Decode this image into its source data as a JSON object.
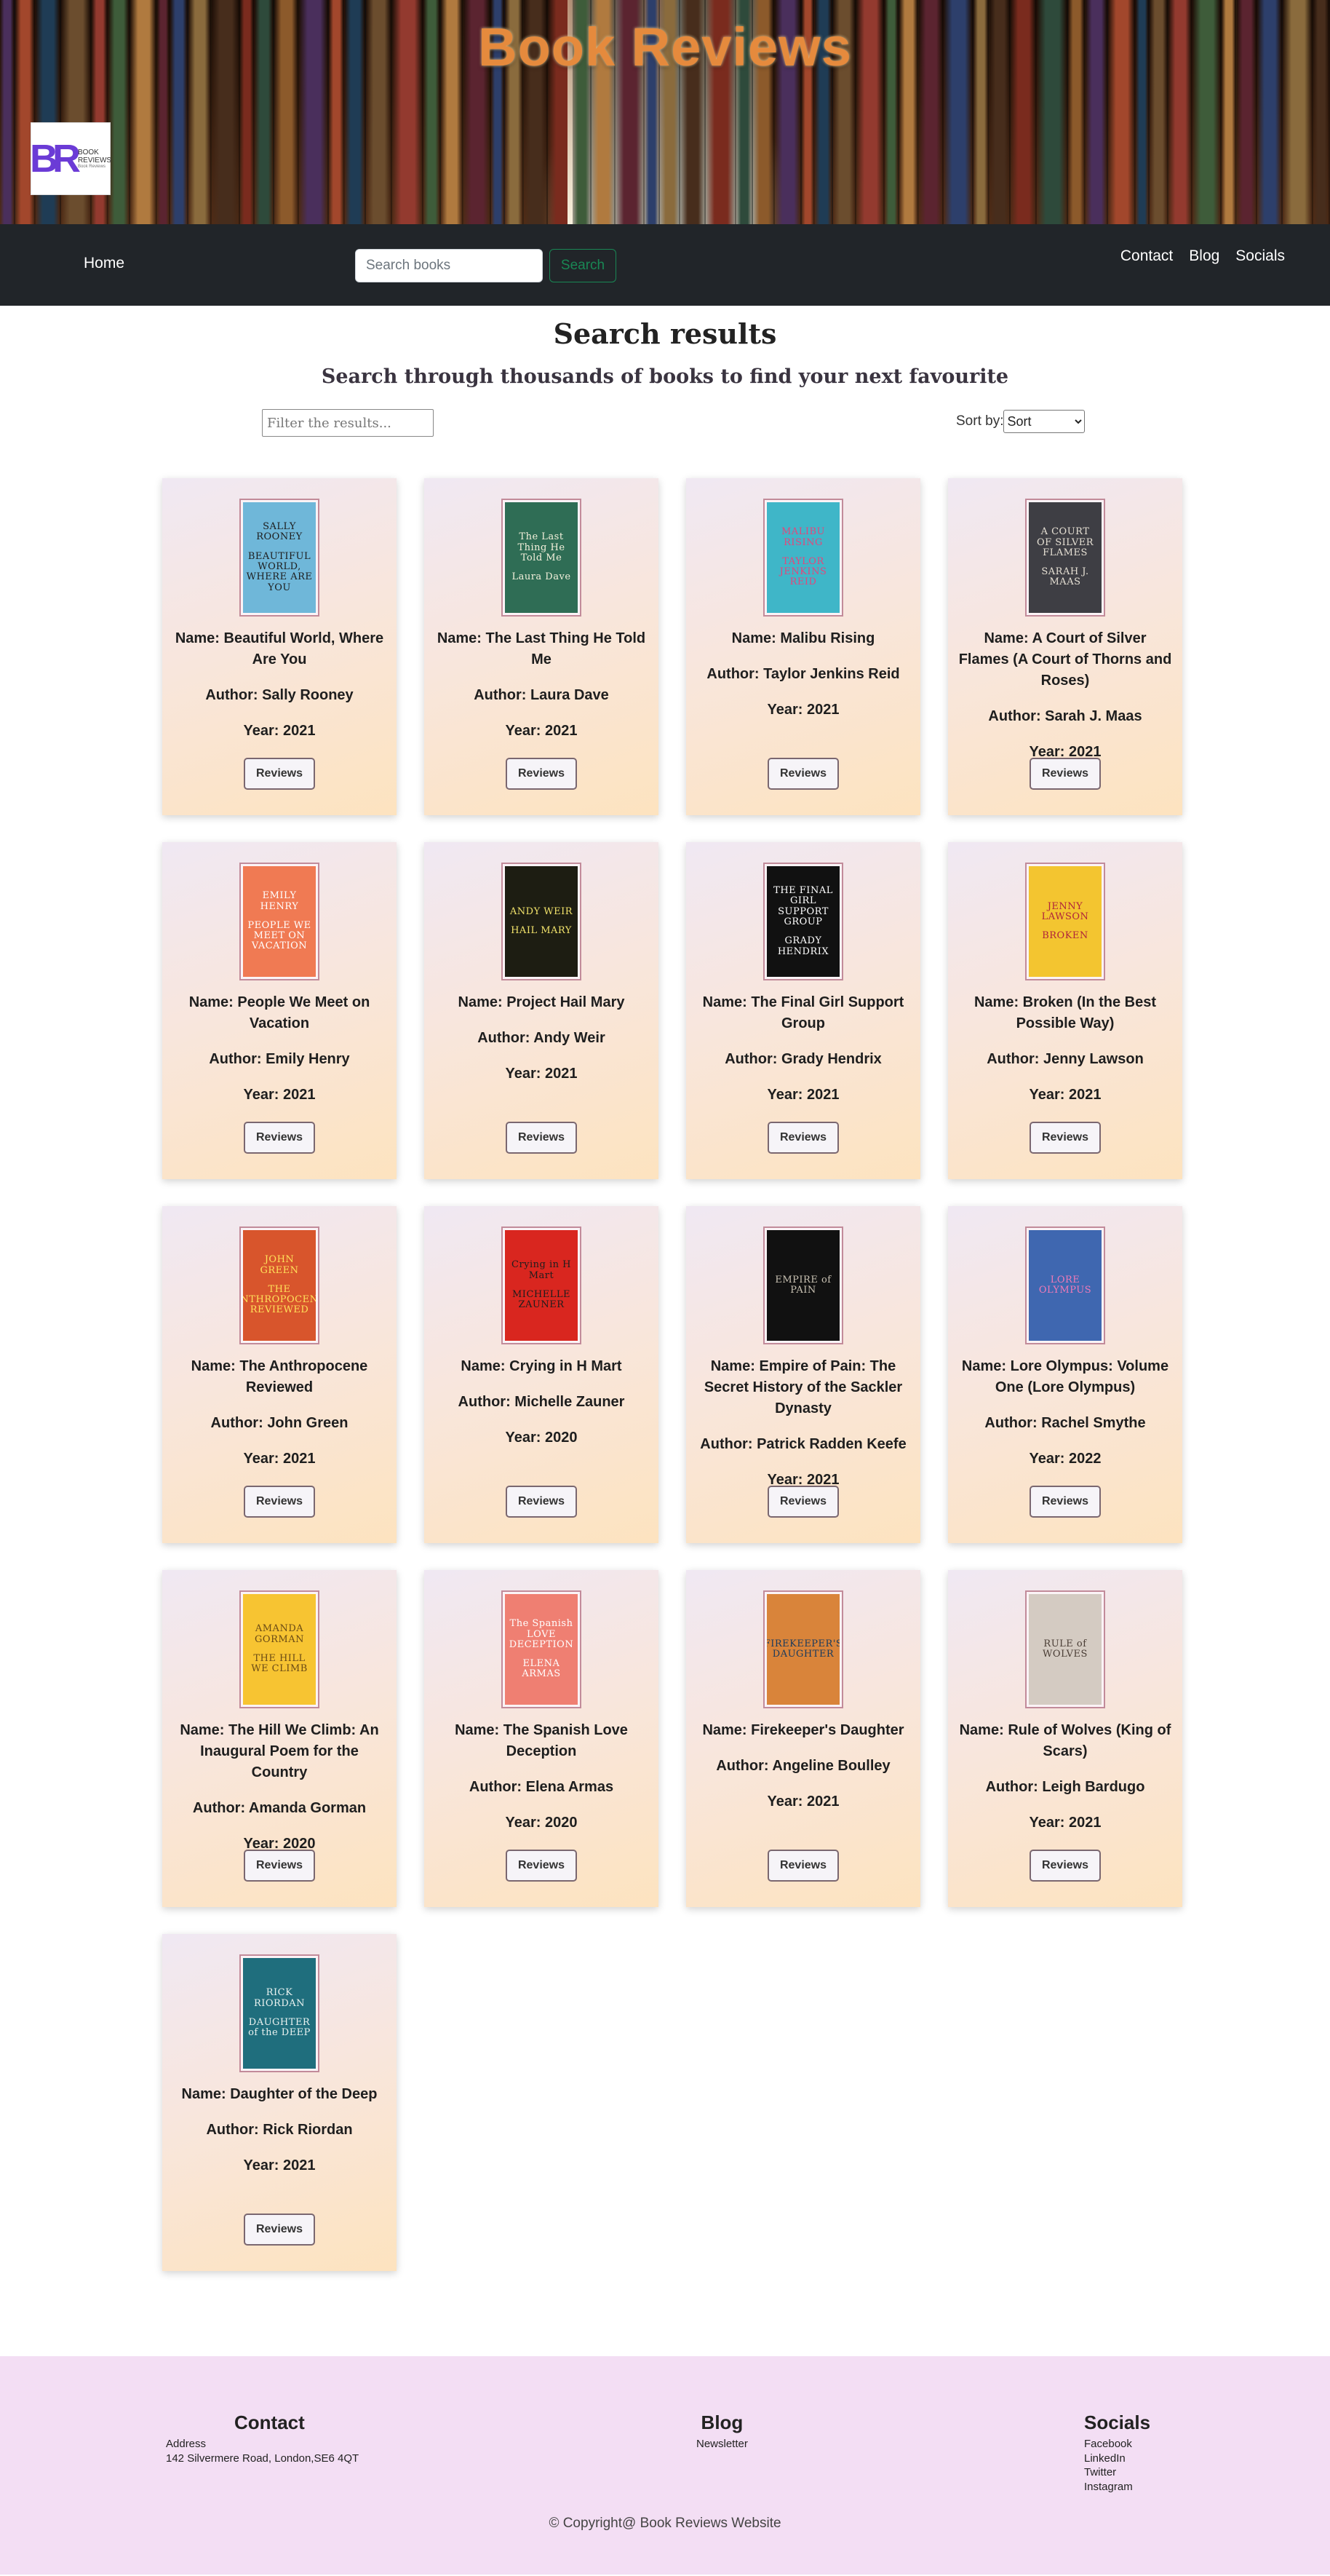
{
  "hero": {
    "title": "Book Reviews",
    "logo_mark": "BR",
    "logo_line1": "BOOK REVIEWS",
    "logo_line2": "Book Reviews"
  },
  "nav": {
    "home": "Home",
    "search_placeholder": "Search books",
    "search_button": "Search",
    "links": [
      "Contact",
      "Blog",
      "Socials"
    ]
  },
  "page": {
    "title": "Search results",
    "subtitle": "Search through thousands of books to find your next favourite",
    "filter_placeholder": "Filter the results...",
    "sort_label": "Sort by:",
    "sort_selected": "Sort"
  },
  "card_labels": {
    "name": "Name: ",
    "author": "Author: ",
    "year": "Year: ",
    "button": "Reviews"
  },
  "books": [
    {
      "name": "Beautiful World, Where Are You",
      "author": "Sally Rooney",
      "year": "2021",
      "cover_text": "SALLY ROONEY\nBEAUTIFUL WORLD, WHERE ARE YOU",
      "cover_bg": "#6fb7d9",
      "cover_fg": "#1d1d1d"
    },
    {
      "name": "The Last Thing He Told Me",
      "author": "Laura Dave",
      "year": "2021",
      "cover_text": "The Last Thing He Told Me\nLaura Dave",
      "cover_bg": "#2f6d55",
      "cover_fg": "#f4f1dc"
    },
    {
      "name": "Malibu Rising",
      "author": "Taylor Jenkins Reid",
      "year": "2021",
      "cover_text": "MALIBU RISING\nTAYLOR JENKINS REID",
      "cover_bg": "#3fb6c8",
      "cover_fg": "#e3477b"
    },
    {
      "name": "A Court of Silver Flames (A Court of Thorns and Roses)",
      "author": "Sarah J. Maas",
      "year": "2021",
      "cover_text": "A COURT OF SILVER FLAMES\nSARAH J. MAAS",
      "cover_bg": "#3e3e44",
      "cover_fg": "#e6e0d4"
    },
    {
      "name": "People We Meet on Vacation",
      "author": "Emily Henry",
      "year": "2021",
      "cover_text": "EMILY HENRY\nPEOPLE WE MEET ON VACATION",
      "cover_bg": "#f07a53",
      "cover_fg": "#ffffff"
    },
    {
      "name": "Project Hail Mary",
      "author": "Andy Weir",
      "year": "2021",
      "cover_text": "ANDY WEIR\nHAIL MARY",
      "cover_bg": "#1d1d12",
      "cover_fg": "#f2e36b"
    },
    {
      "name": "The Final Girl Support Group",
      "author": "Grady Hendrix",
      "year": "2021",
      "cover_text": "THE FINAL GIRL SUPPORT GROUP\nGRADY HENDRIX",
      "cover_bg": "#111111",
      "cover_fg": "#ffffff"
    },
    {
      "name": "Broken (In the Best Possible Way)",
      "author": "Jenny Lawson",
      "year": "2021",
      "cover_text": "JENNY LAWSON\nBROKEN",
      "cover_bg": "#f3c530",
      "cover_fg": "#b0233b"
    },
    {
      "name": "The Anthropocene Reviewed",
      "author": "John Green",
      "year": "2021",
      "cover_text": "JOHN GREEN\nTHE ANTHROPOCENE REVIEWED",
      "cover_bg": "#d8552c",
      "cover_fg": "#ffe15a"
    },
    {
      "name": "Crying in H Mart",
      "author": "Michelle Zauner",
      "year": "2020",
      "cover_text": "Crying in H Mart\nMICHELLE ZAUNER",
      "cover_bg": "#d9261f",
      "cover_fg": "#1d1d1d"
    },
    {
      "name": "Empire of Pain: The Secret History of the Sackler Dynasty",
      "author": "Patrick Radden Keefe",
      "year": "2021",
      "cover_text": "EMPIRE of PAIN",
      "cover_bg": "#111111",
      "cover_fg": "#c9c2b3"
    },
    {
      "name": "Lore Olympus: Volume One (Lore Olympus)",
      "author": "Rachel Smythe",
      "year": "2022",
      "cover_text": "LORE OLYMPUS",
      "cover_bg": "#3f67b0",
      "cover_fg": "#f07ab8"
    },
    {
      "name": "The Hill We Climb: An Inaugural Poem for the Country",
      "author": "Amanda Gorman",
      "year": "2020",
      "cover_text": "AMANDA GORMAN\nTHE HILL WE CLIMB",
      "cover_bg": "#f7c432",
      "cover_fg": "#6a4a15"
    },
    {
      "name": "The Spanish Love Deception",
      "author": "Elena Armas",
      "year": "2020",
      "cover_text": "The Spanish LOVE DECEPTION\nELENA ARMAS",
      "cover_bg": "#ef7f72",
      "cover_fg": "#ffffff"
    },
    {
      "name": "Firekeeper's Daughter",
      "author": "Angeline Boulley",
      "year": "2021",
      "cover_text": "FIREKEEPER'S DAUGHTER",
      "cover_bg": "#d9843a",
      "cover_fg": "#183a5e"
    },
    {
      "name": "Rule of Wolves (King of Scars)",
      "author": "Leigh Bardugo",
      "year": "2021",
      "cover_text": "RULE of WOLVES",
      "cover_bg": "#d4cbc2",
      "cover_fg": "#4a3d35"
    },
    {
      "name": "Daughter of the Deep",
      "author": "Rick Riordan",
      "year": "2021",
      "cover_text": "RICK RIORDAN\nDAUGHTER of the DEEP",
      "cover_bg": "#1f6e7d",
      "cover_fg": "#e9f2f0"
    }
  ],
  "footer": {
    "contact_title": "Contact",
    "address_label": "Address",
    "address": "142 Silvermere Road, London,SE6 4QT",
    "blog_title": "Blog",
    "blog_item": "Newsletter",
    "socials_title": "Socials",
    "socials": [
      "Facebook",
      "LinkedIn",
      "Twitter",
      "Instagram"
    ],
    "copyright": "© Copyright@ Book Reviews Website"
  },
  "colors": {
    "nav_bg": "#212529",
    "footer_bg": "#f3def4",
    "search_green": "#198754",
    "title_orange": "#e58a3d"
  }
}
